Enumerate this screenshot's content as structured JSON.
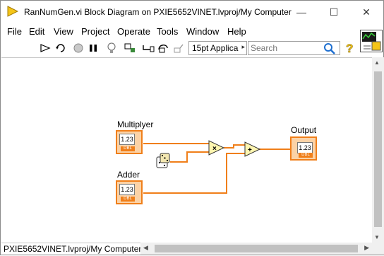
{
  "window": {
    "title": "RanNumGen.vi Block Diagram on PXIE5652VINET.lvproj/My Computer",
    "minimize_glyph": "—",
    "maximize_glyph": "☐",
    "close_glyph": "✕"
  },
  "menu": {
    "items": [
      "File",
      "Edit",
      "View",
      "Project",
      "Operate",
      "Tools",
      "Window",
      "Help"
    ]
  },
  "toolbar": {
    "font_select": "15pt Applica",
    "font_select_arrow": "▸",
    "search_placeholder": "Search"
  },
  "diagram": {
    "controls": [
      {
        "label": "Multiplyer",
        "value_display": "1.23",
        "type_badge": "DBL"
      },
      {
        "label": "Adder",
        "value_display": "1.23",
        "type_badge": "DBL"
      }
    ],
    "indicator": {
      "label": "Output",
      "value_display": "1.23",
      "type_badge": "DBL"
    },
    "functions": [
      {
        "name": "multiply",
        "symbol": "×"
      },
      {
        "name": "add",
        "symbol": "+"
      }
    ],
    "random_icon": "dice-icon"
  },
  "status": {
    "path": "PXIE5652VINET.lvproj/My Computer"
  },
  "colors": {
    "numeric_orange": "#f07f1a",
    "wire_orange": "#f07f1a",
    "function_fill": "#fff6b0"
  }
}
